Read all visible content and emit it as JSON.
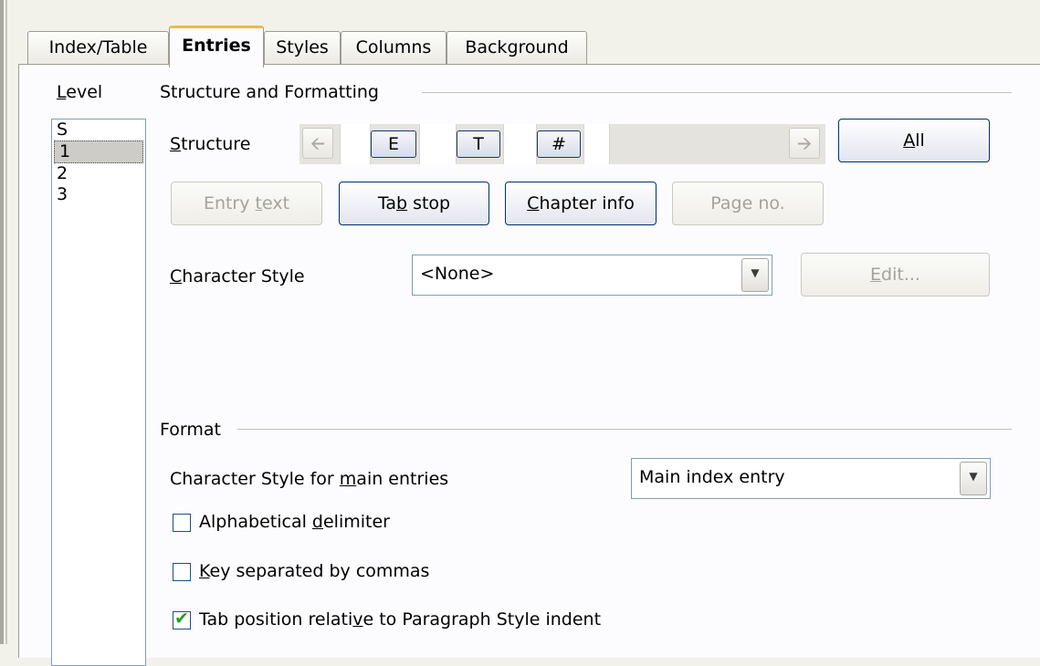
{
  "tabs": [
    {
      "label": "Index/Table"
    },
    {
      "label": "Entries"
    },
    {
      "label": "Styles"
    },
    {
      "label": "Columns"
    },
    {
      "label": "Background"
    }
  ],
  "level": {
    "label_key": "L",
    "label_rest": "evel",
    "items": [
      "S",
      "1",
      "2",
      "3"
    ],
    "selected": "1"
  },
  "structure_formatting": {
    "title": "Structure and Formatting",
    "structure_label_key": "S",
    "structure_label_rest": "tructure",
    "left_arrow_icon": "arrow-left-icon",
    "right_arrow_icon": "arrow-right-icon",
    "tokens": [
      "E",
      "T",
      "#"
    ],
    "all_button_key": "A",
    "all_button_rest": "ll",
    "entry_text_pre": "Entry ",
    "entry_text_key": "t",
    "entry_text_post": "ext",
    "tab_stop_pre": "Ta",
    "tab_stop_key": "b",
    "tab_stop_post": " stop",
    "chapter_info_key": "C",
    "chapter_info_post": "hapter info",
    "page_no_pre": "Pa",
    "page_no_key": "g",
    "page_no_post": "e no.",
    "char_style_key": "C",
    "char_style_rest": "haracter Style",
    "char_style_value": "<None>",
    "edit_key": "E",
    "edit_rest": "dit..."
  },
  "format": {
    "title": "Format",
    "main_entries_pre": "Character Style for ",
    "main_entries_key": "m",
    "main_entries_post": "ain entries",
    "main_entries_value": "Main index entry",
    "alpha_pre": "Alphabetical ",
    "alpha_key": "d",
    "alpha_post": "elimiter",
    "alpha_checked": false,
    "key_key": "K",
    "key_post": "ey separated by commas",
    "key_checked": false,
    "tabpos_pre": "Tab position relati",
    "tabpos_key": "v",
    "tabpos_post": "e to Paragraph Style indent",
    "tabpos_checked": true
  },
  "colors": {
    "active_tab_accent": "#f0b94d",
    "check_mark": "#21a121",
    "button_border": "#00306e"
  }
}
